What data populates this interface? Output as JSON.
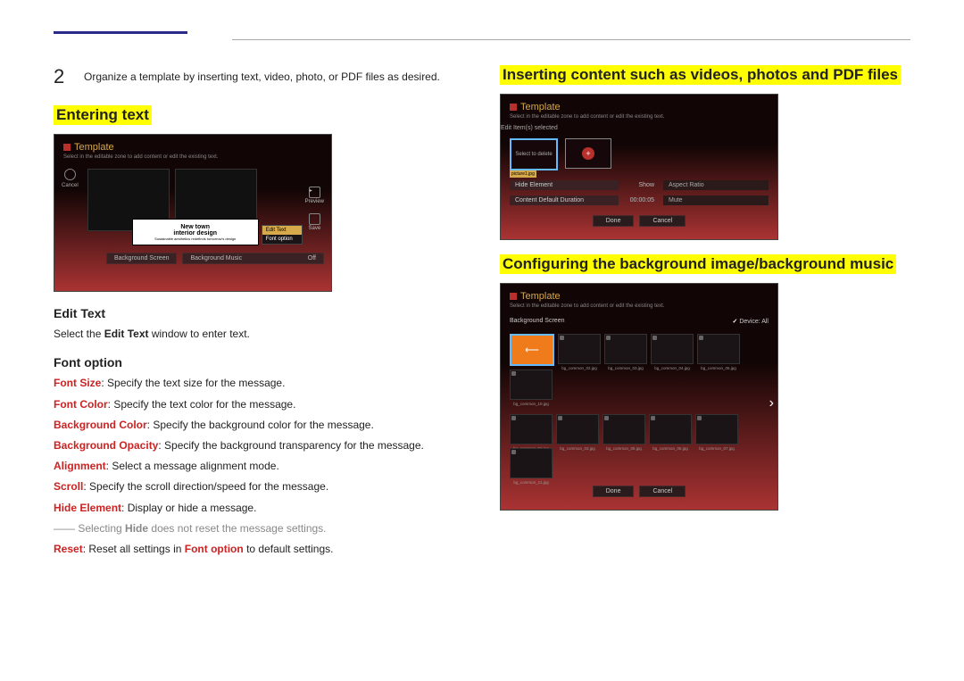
{
  "step": {
    "number": "2",
    "text": "Organize a template by inserting text, video, photo, or PDF files as desired."
  },
  "headings": {
    "entering_text": "Entering text",
    "inserting": "Inserting content such as videos, photos and PDF files",
    "configuring": "Configuring the background image/background music",
    "edit_text": "Edit Text",
    "font_option": "Font option"
  },
  "edit_text_desc": {
    "pre": "Select the ",
    "bold": "Edit Text",
    "post": " window to enter text."
  },
  "font_options": [
    {
      "label": "Font Size",
      "desc": ": Specify the text size for the message."
    },
    {
      "label": "Font Color",
      "desc": ": Specify the text color for the message."
    },
    {
      "label": "Background Color",
      "desc": ": Specify the background color for the message."
    },
    {
      "label": "Background Opacity",
      "desc": ": Specify the background transparency for the message."
    },
    {
      "label": "Alignment",
      "desc": ": Select a message alignment mode."
    },
    {
      "label": "Scroll",
      "desc": ": Specify the scroll direction/speed for the message."
    },
    {
      "label": "Hide Element",
      "desc": ": Display or hide a message."
    }
  ],
  "note": {
    "pre": "―― Selecting ",
    "bold": "Hide",
    "post": " does not reset the message settings."
  },
  "reset": {
    "label": "Reset",
    "mid": ": Reset all settings in ",
    "bold2": "Font option",
    "post": " to default settings."
  },
  "shot1": {
    "title": "Template",
    "sub": "Select in the editable zone to add content or edit the existing text.",
    "cancel": "Cancel",
    "preview": "Preview",
    "save": "Save",
    "text1": "New town",
    "text2": "interior design",
    "text3": "Sustainable aesthetics redefinds tomorrow's design",
    "menu_edit": "Edit Text",
    "menu_font": "Font option",
    "bg_screen": "Background Screen",
    "bg_music": "Background Music",
    "off": "Off"
  },
  "shot2": {
    "title": "Template",
    "sub": "Select in the editable zone to add content or edit the existing text.",
    "edit": "Edit",
    "items_selected": "Item(s) selected",
    "select_to_delete": "Select to delete",
    "filename": "picture1.jpg",
    "hide_element": "Hide Element",
    "show": "Show",
    "aspect": "Aspect Ratio",
    "cdd": "Content Default Duration",
    "duration": "00:00:05",
    "mute": "Mute",
    "done": "Done",
    "cancel": "Cancel"
  },
  "shot3": {
    "title": "Template",
    "sub": "Select in the editable zone to add content or edit the existing text.",
    "bg_screen": "Background Screen",
    "device": "Device: All",
    "files": [
      "",
      "bg_common_02.jpg",
      "bg_common_03.jpg",
      "bg_common_04.jpg",
      "bg_common_06.jpg",
      "bg_common_10.jpg",
      "bg_common_01.jpg",
      "bg_common_03.jpg",
      "bg_common_05.jpg",
      "bg_common_05.jpg",
      "bg_common_07.jpg",
      "bg_common_11.jpg",
      "bg_comm"
    ],
    "done": "Done",
    "cancel": "Cancel"
  }
}
